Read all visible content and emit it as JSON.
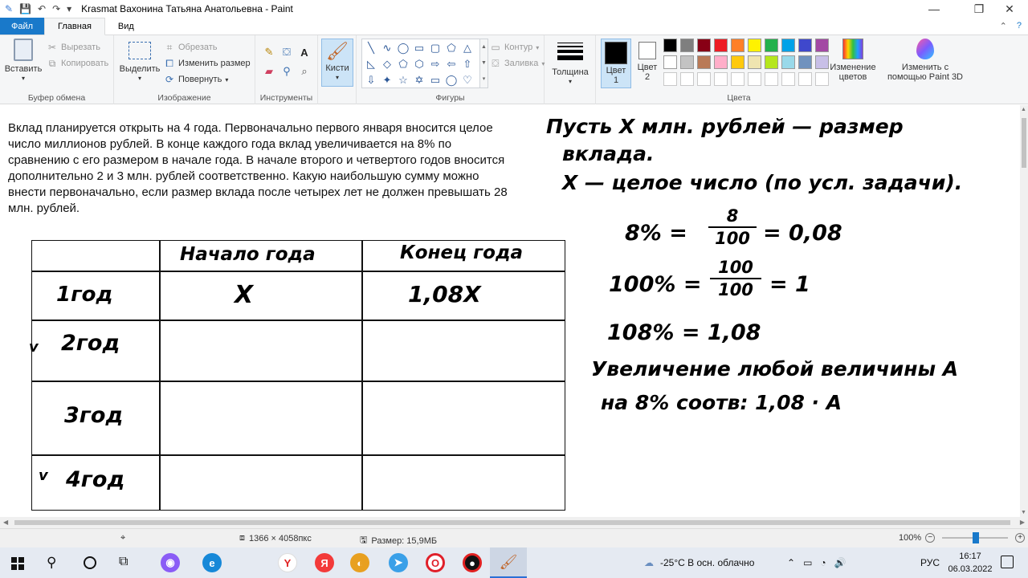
{
  "window": {
    "title": "Krasmat Вахонина Татьяна Анатольевна - Paint",
    "controls": {
      "minimize": "—",
      "maximize": "❐",
      "close": "✕"
    }
  },
  "tabs": {
    "file": "Файл",
    "home": "Главная",
    "view": "Вид"
  },
  "ribbon": {
    "clipboard": {
      "paste": "Вставить",
      "cut": "Вырезать",
      "copy": "Копировать",
      "label": "Буфер обмена"
    },
    "image": {
      "select": "Выделить",
      "crop": "Обрезать",
      "resize": "Изменить размер",
      "rotate": "Повернуть",
      "label": "Изображение"
    },
    "tools": {
      "label": "Инструменты"
    },
    "brushes": {
      "label": "Кисти"
    },
    "shapes": {
      "outline": "Контур",
      "fill": "Заливка",
      "label": "Фигуры"
    },
    "size": {
      "label": "Толщина"
    },
    "colors": {
      "color1": "Цвет 1",
      "color2": "Цвет 2",
      "edit": "Изменение цветов",
      "paint3d": "Изменить с помощью Paint 3D",
      "label": "Цвета",
      "palette_row1": [
        "#000000",
        "#7f7f7f",
        "#880015",
        "#ed1c24",
        "#ff7f27",
        "#fff200",
        "#22b14c",
        "#00a2e8",
        "#3f48cc",
        "#a349a4"
      ],
      "palette_row2": [
        "#ffffff",
        "#c3c3c3",
        "#b97a57",
        "#ffaec9",
        "#ffc90e",
        "#efe4b0",
        "#b5e61d",
        "#99d9ea",
        "#7092be",
        "#c8bfe7"
      ],
      "color1_value": "#000000",
      "color2_value": "#ffffff"
    }
  },
  "canvas": {
    "problem_text": "Вклад планируется открыть на 4 года. Первоначально первого января вносится целое число миллионов рублей. В конце каждого года вклад увеличивается на 8% по сравнению с его размером в начале года. В начале второго и четвертого годов вносится дополнительно 2 и 3 млн. рублей соответственно. Какую наибольшую сумму можно внести первоначально, если размер вклада после четырех лет не должен превышать 28 млн. рублей.",
    "table": {
      "headers": [
        "Начало года",
        "Конец года"
      ],
      "rows": [
        {
          "label": "1год",
          "mark": "",
          "start": "X",
          "end": "1,08X"
        },
        {
          "label": "2год",
          "mark": "v",
          "start": "",
          "end": ""
        },
        {
          "label": "3год",
          "mark": "",
          "start": "",
          "end": ""
        },
        {
          "label": "4год",
          "mark": "v",
          "start": "",
          "end": ""
        }
      ]
    },
    "notes": {
      "line1": "Пусть X млн. рублей — размер",
      "line2": "вклада.",
      "line3": "X — целое число (по усл. задачи).",
      "pct8_left": "8% =",
      "pct8_num": "8",
      "pct8_den": "100",
      "pct8_right": "= 0,08",
      "pct100_left": "100% =",
      "pct100_num": "100",
      "pct100_den": "100",
      "pct100_right": "= 1",
      "pct108": "108% = 1,08",
      "line_inc1": "Увеличение любой величины A",
      "line_inc2": "на 8%  соотв:  1,08 · A"
    }
  },
  "status": {
    "dimensions": "1366 × 4058пкс",
    "size": "Размер: 15,9МБ",
    "zoom": "100%"
  },
  "taskbar": {
    "weather": "-25°C  В осн. облачно",
    "lang": "РУС",
    "time": "16:17",
    "date": "06.03.2022"
  }
}
